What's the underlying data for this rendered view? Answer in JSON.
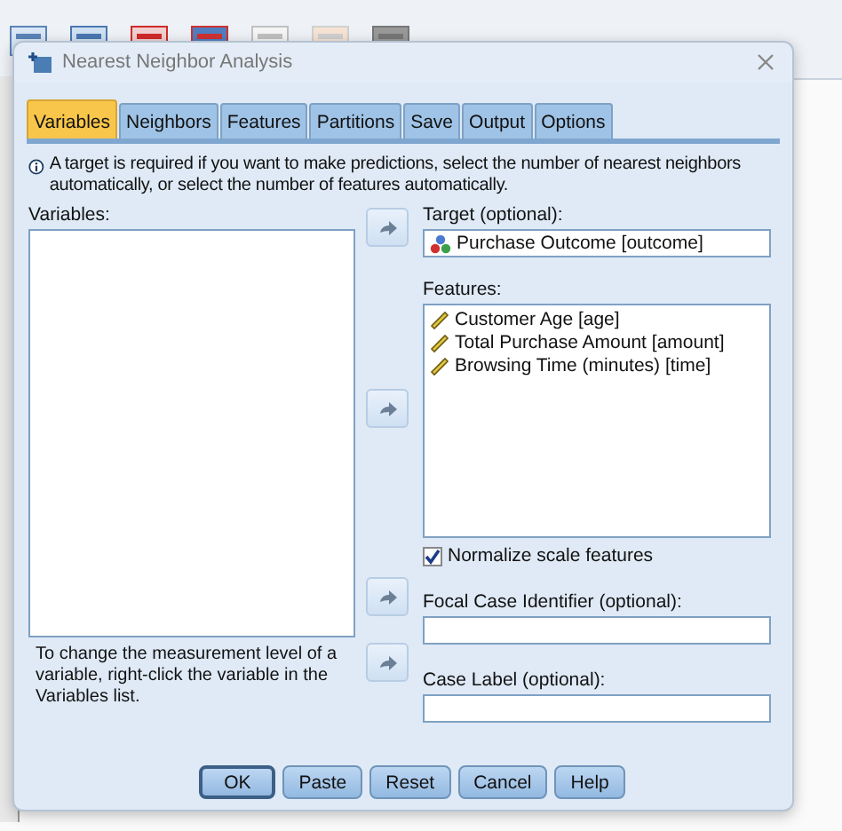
{
  "window": {
    "title": "Nearest Neighbor Analysis"
  },
  "tabs": [
    {
      "label": "Variables",
      "selected": true
    },
    {
      "label": "Neighbors",
      "selected": false
    },
    {
      "label": "Features",
      "selected": false
    },
    {
      "label": "Partitions",
      "selected": false
    },
    {
      "label": "Save",
      "selected": false
    },
    {
      "label": "Output",
      "selected": false
    },
    {
      "label": "Options",
      "selected": false
    }
  ],
  "info": "A target is required if you want to make predictions, select the number of nearest neighbors automatically, or select the number of features automatically.",
  "variables": {
    "label": "Variables:",
    "note": "To change the measurement level of a variable, right-click the variable in the Variables list."
  },
  "target": {
    "label": "Target (optional):",
    "value": "Purchase Outcome [outcome]"
  },
  "features": {
    "label": "Features:",
    "items": [
      "Customer Age [age]",
      "Total Purchase Amount [amount]",
      "Browsing Time (minutes) [time]"
    ]
  },
  "normalize": {
    "label": "Normalize scale features",
    "checked": true
  },
  "focal": {
    "label": "Focal Case Identifier (optional):"
  },
  "case_label": {
    "label": "Case Label (optional):"
  },
  "buttons": [
    {
      "label": "OK",
      "default": true
    },
    {
      "label": "Paste",
      "default": false
    },
    {
      "label": "Reset",
      "default": false
    },
    {
      "label": "Cancel",
      "default": false
    },
    {
      "label": "Help",
      "default": false
    }
  ]
}
